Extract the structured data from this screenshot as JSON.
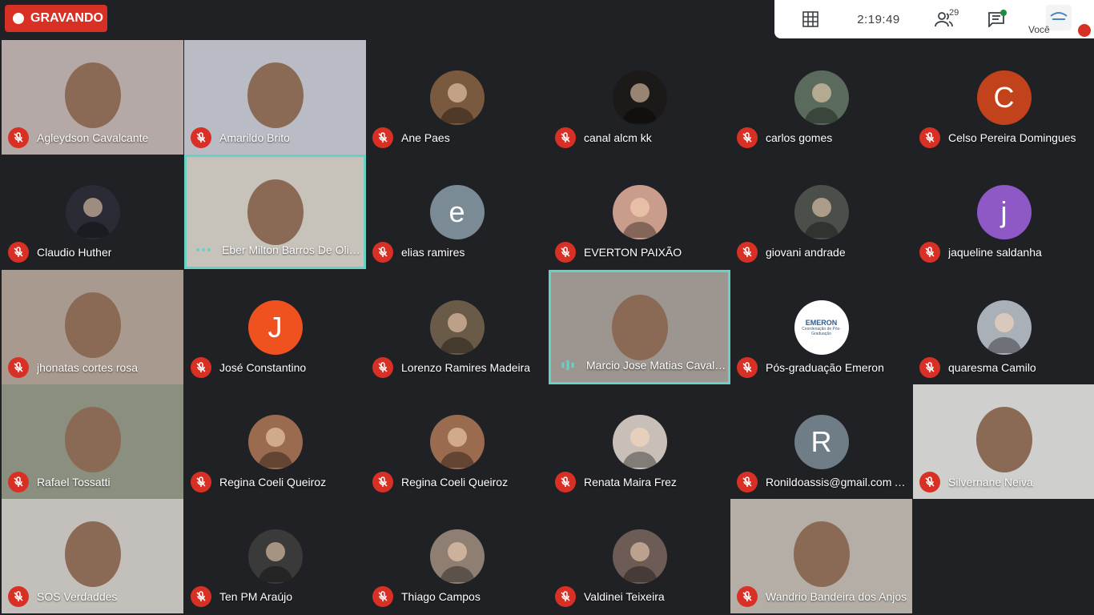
{
  "recording": {
    "label": "GRAVANDO"
  },
  "topbar": {
    "clock": "2:19:49",
    "participants_count": "29",
    "self_label": "Você",
    "colors": {
      "accent": "#d93025",
      "speaking_border": "#66d2c5",
      "chat_dot": "#1e8e3e"
    }
  },
  "tiles": [
    {
      "name": "Agleydson Cavalcante",
      "type": "video",
      "bg": "#b5a9a7"
    },
    {
      "name": "Amarildo Brito",
      "type": "video",
      "bg": "#b9bcc4"
    },
    {
      "name": "Ane Paes",
      "type": "photo",
      "bg": "#7a5a3e"
    },
    {
      "name": "canal alcm kk",
      "type": "photo",
      "bg": "#1c1a18"
    },
    {
      "name": "carlos gomes",
      "type": "photo",
      "bg": "#5a6a5c"
    },
    {
      "name": "Celso Pereira Domingues",
      "type": "letter",
      "letter": "C",
      "bg": "#c1421b"
    },
    {
      "name": "Claudio Huther",
      "type": "photo",
      "bg": "#2a2b35"
    },
    {
      "name": "Eber Milton Barros De Oliveira",
      "type": "video",
      "bg": "#c7c3bb",
      "speaking": true
    },
    {
      "name": "elias ramires",
      "type": "letter",
      "letter": "e",
      "bg": "#7b8b95"
    },
    {
      "name": "EVERTON PAIXÃO",
      "type": "photo",
      "bg": "#c99c8b"
    },
    {
      "name": "giovani andrade",
      "type": "photo",
      "bg": "#4a4f4a"
    },
    {
      "name": "jaqueline saldanha",
      "type": "letter",
      "letter": "j",
      "bg": "#8e58c6"
    },
    {
      "name": "jhonatas cortes rosa",
      "type": "video",
      "bg": "#a99a90"
    },
    {
      "name": "José Constantino",
      "type": "letter",
      "letter": "J",
      "bg": "#f0521f"
    },
    {
      "name": "Lorenzo Ramires Madeira",
      "type": "photo",
      "bg": "#6a5a48"
    },
    {
      "name": "Marcio Jose Matias Cavalcante",
      "type": "video",
      "bg": "#9d9690",
      "speaking": true
    },
    {
      "name": "Pós-graduação Emeron",
      "type": "logo",
      "logo_text": "EMERON",
      "logo_sub": "Coordenação de Pós-Graduação",
      "bg": "#ffffff"
    },
    {
      "name": "quaresma Camilo",
      "type": "photo",
      "bg": "#aab0b8"
    },
    {
      "name": "Rafael Tossatti",
      "type": "video",
      "bg": "#8a8f80"
    },
    {
      "name": "Regina Coeli Queiroz",
      "type": "photo",
      "bg": "#9a6b4f"
    },
    {
      "name": "Regina Coeli Queiroz",
      "type": "photo",
      "bg": "#9a6b4f"
    },
    {
      "name": "Renata Maira Frez",
      "type": "photo",
      "bg": "#c8bfb8"
    },
    {
      "name": "Ronildoassis@gmail.com Assis",
      "type": "letter",
      "letter": "R",
      "bg": "#6f7d86"
    },
    {
      "name": "Silvernane Neiva",
      "type": "video",
      "bg": "#cfcfcd"
    },
    {
      "name": "SOS Verdaddes",
      "type": "video",
      "bg": "#c3c0bb"
    },
    {
      "name": "Ten PM Araújo",
      "type": "photo",
      "bg": "#3a3a3a"
    },
    {
      "name": "Thiago Campos",
      "type": "photo",
      "bg": "#8f7f72"
    },
    {
      "name": "Valdinei Teixeira",
      "type": "photo",
      "bg": "#6c5c55"
    },
    {
      "name": "Wandrio Bandeira dos Anjos",
      "type": "video",
      "bg": "#b4aea6"
    }
  ]
}
